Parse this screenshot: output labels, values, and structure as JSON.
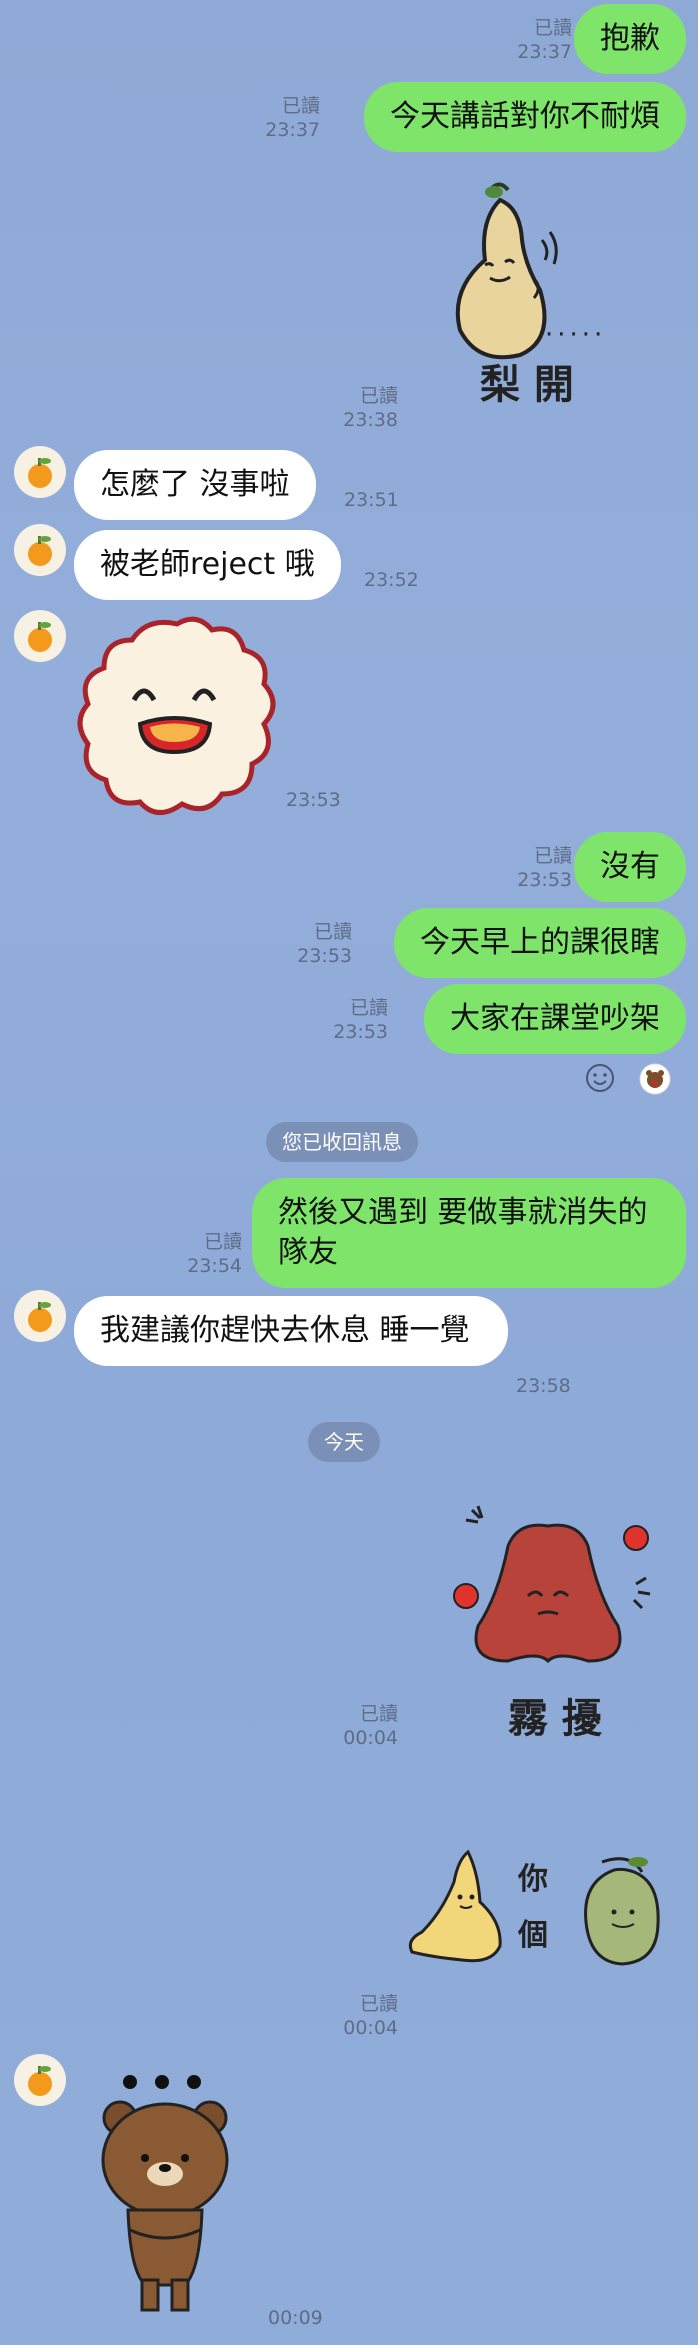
{
  "messages": {
    "m1": {
      "read": "已讀",
      "time": "23:37",
      "text": "抱歉"
    },
    "m2": {
      "read": "已讀",
      "time": "23:37",
      "text": "今天講話對你不耐煩"
    },
    "m3": {
      "read": "已讀",
      "time": "23:38",
      "sticker_text": "梨 開",
      "sticker_dots": "·····"
    },
    "m4": {
      "time": "23:51",
      "text": "怎麼了 沒事啦"
    },
    "m5": {
      "time": "23:52",
      "text": "被老師reject 哦"
    },
    "m6": {
      "time": "23:53"
    },
    "m7": {
      "read": "已讀",
      "time": "23:53",
      "text": "沒有"
    },
    "m8": {
      "read": "已讀",
      "time": "23:53",
      "text": "今天早上的課很瞎"
    },
    "m9": {
      "read": "已讀",
      "time": "23:53",
      "text": "大家在課堂吵架"
    },
    "unsent": "您已收回訊息",
    "m10": {
      "read": "已讀",
      "time": "23:54",
      "text": "然後又遇到 要做事就消失的隊友"
    },
    "m11": {
      "time": "23:58",
      "text": "我建議你趕快去休息 睡一覺"
    },
    "date_divider": "今天",
    "m12": {
      "read": "已讀",
      "time": "00:04",
      "sticker_text": "霧 擾"
    },
    "m13": {
      "read": "已讀",
      "time": "00:04",
      "sticker_text": "你 個"
    },
    "m14": {
      "time": "00:09"
    }
  },
  "colors": {
    "outgoing": "#7ee56a",
    "incoming": "#ffffff",
    "background": "#8fa9d6"
  },
  "icons": [
    "orange-avatar-icon",
    "smile-reaction-icon",
    "bear-reaction-icon"
  ]
}
